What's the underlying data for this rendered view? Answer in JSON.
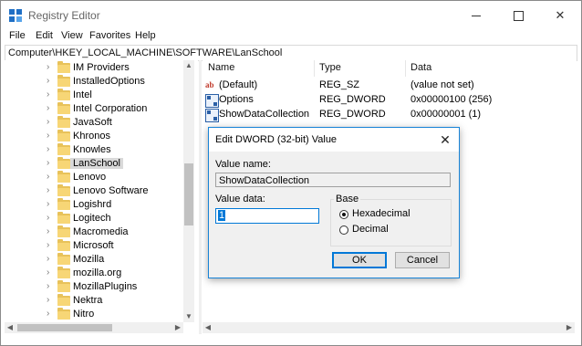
{
  "window": {
    "title": "Registry Editor",
    "minimize_icon": "minimize-icon",
    "maximize_icon": "maximize-icon",
    "close_icon": "close-icon",
    "close_glyph": "✕"
  },
  "menu": [
    "File",
    "Edit",
    "View",
    "Favorites",
    "Help"
  ],
  "address": "Computer\\HKEY_LOCAL_MACHINE\\SOFTWARE\\LanSchool",
  "tree": {
    "items": [
      {
        "label": "IM Providers",
        "selected": false
      },
      {
        "label": "InstalledOptions",
        "selected": false
      },
      {
        "label": "Intel",
        "selected": false
      },
      {
        "label": "Intel Corporation",
        "selected": false
      },
      {
        "label": "JavaSoft",
        "selected": false
      },
      {
        "label": "Khronos",
        "selected": false
      },
      {
        "label": "Knowles",
        "selected": false
      },
      {
        "label": "LanSchool",
        "selected": true
      },
      {
        "label": "Lenovo",
        "selected": false
      },
      {
        "label": "Lenovo Software",
        "selected": false
      },
      {
        "label": "Logishrd",
        "selected": false
      },
      {
        "label": "Logitech",
        "selected": false
      },
      {
        "label": "Macromedia",
        "selected": false
      },
      {
        "label": "Microsoft",
        "selected": false
      },
      {
        "label": "Mozilla",
        "selected": false
      },
      {
        "label": "mozilla.org",
        "selected": false
      },
      {
        "label": "MozillaPlugins",
        "selected": false
      },
      {
        "label": "Nektra",
        "selected": false
      },
      {
        "label": "Nitro",
        "selected": false
      }
    ],
    "expand_glyph": "›"
  },
  "values": {
    "headers": {
      "name": "Name",
      "type": "Type",
      "data": "Data"
    },
    "rows": [
      {
        "name": "(Default)",
        "type": "REG_SZ",
        "data": "(value not set)",
        "icon": "string-value-icon"
      },
      {
        "name": "Options",
        "type": "REG_DWORD",
        "data": "0x00000100 (256)",
        "icon": "binary-value-icon"
      },
      {
        "name": "ShowDataCollection",
        "type": "REG_DWORD",
        "data": "0x00000001 (1)",
        "icon": "binary-value-icon"
      }
    ]
  },
  "dialog": {
    "title": "Edit DWORD (32-bit) Value",
    "value_name_label": "Value name:",
    "value_name": "ShowDataCollection",
    "value_data_label": "Value data:",
    "value_data": "1",
    "base_label": "Base",
    "hex_label": "Hexadecimal",
    "dec_label": "Decimal",
    "base_selected": "Hexadecimal",
    "ok_label": "OK",
    "cancel_label": "Cancel"
  },
  "colors": {
    "accent": "#0078d7",
    "selection": "#d9d9d9",
    "folder": "#f7d676"
  }
}
